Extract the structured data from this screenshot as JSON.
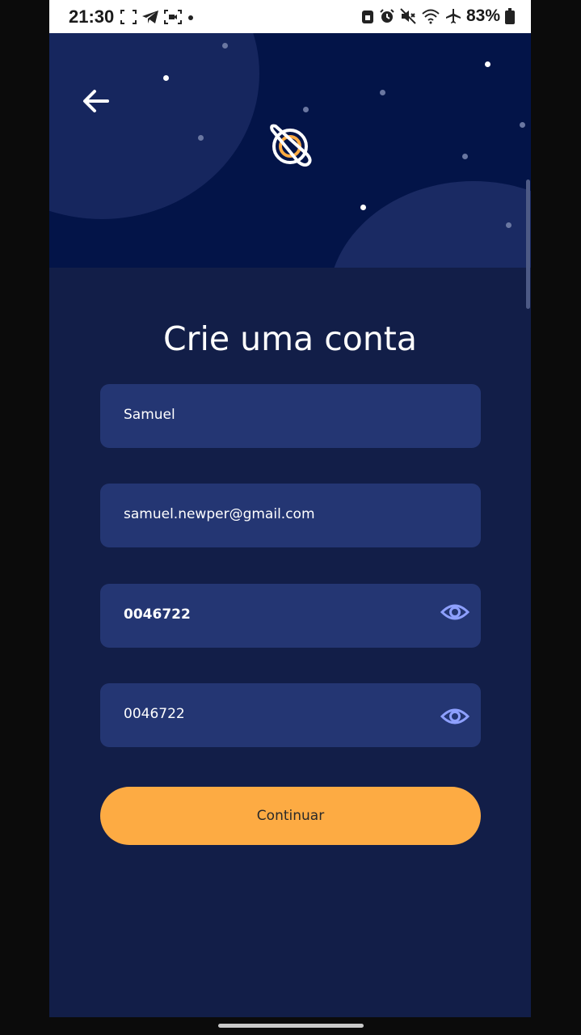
{
  "status_bar": {
    "time": "21:30",
    "battery": "83%",
    "left_icons": [
      "screenshot-icon",
      "telegram-icon",
      "screen-record-icon",
      "dot-icon"
    ],
    "right_icons": [
      "lock-icon",
      "alarm-icon",
      "mute-icon",
      "wifi-icon",
      "airplane-icon",
      "battery-icon"
    ]
  },
  "header": {
    "back_icon": "arrow-left-icon",
    "logo_icon": "planet-logo-icon"
  },
  "form": {
    "title": "Crie uma conta",
    "name_value": "Samuel",
    "email_value": "samuel.newper@gmail.com",
    "password_value": "0046722",
    "confirm_password_value": "0046722",
    "continue_label": "Continuar"
  },
  "colors": {
    "background": "#121e48",
    "header": "#031448",
    "field": "#243673",
    "accent": "#fdab43",
    "eye_icon": "#8ea0ff"
  }
}
